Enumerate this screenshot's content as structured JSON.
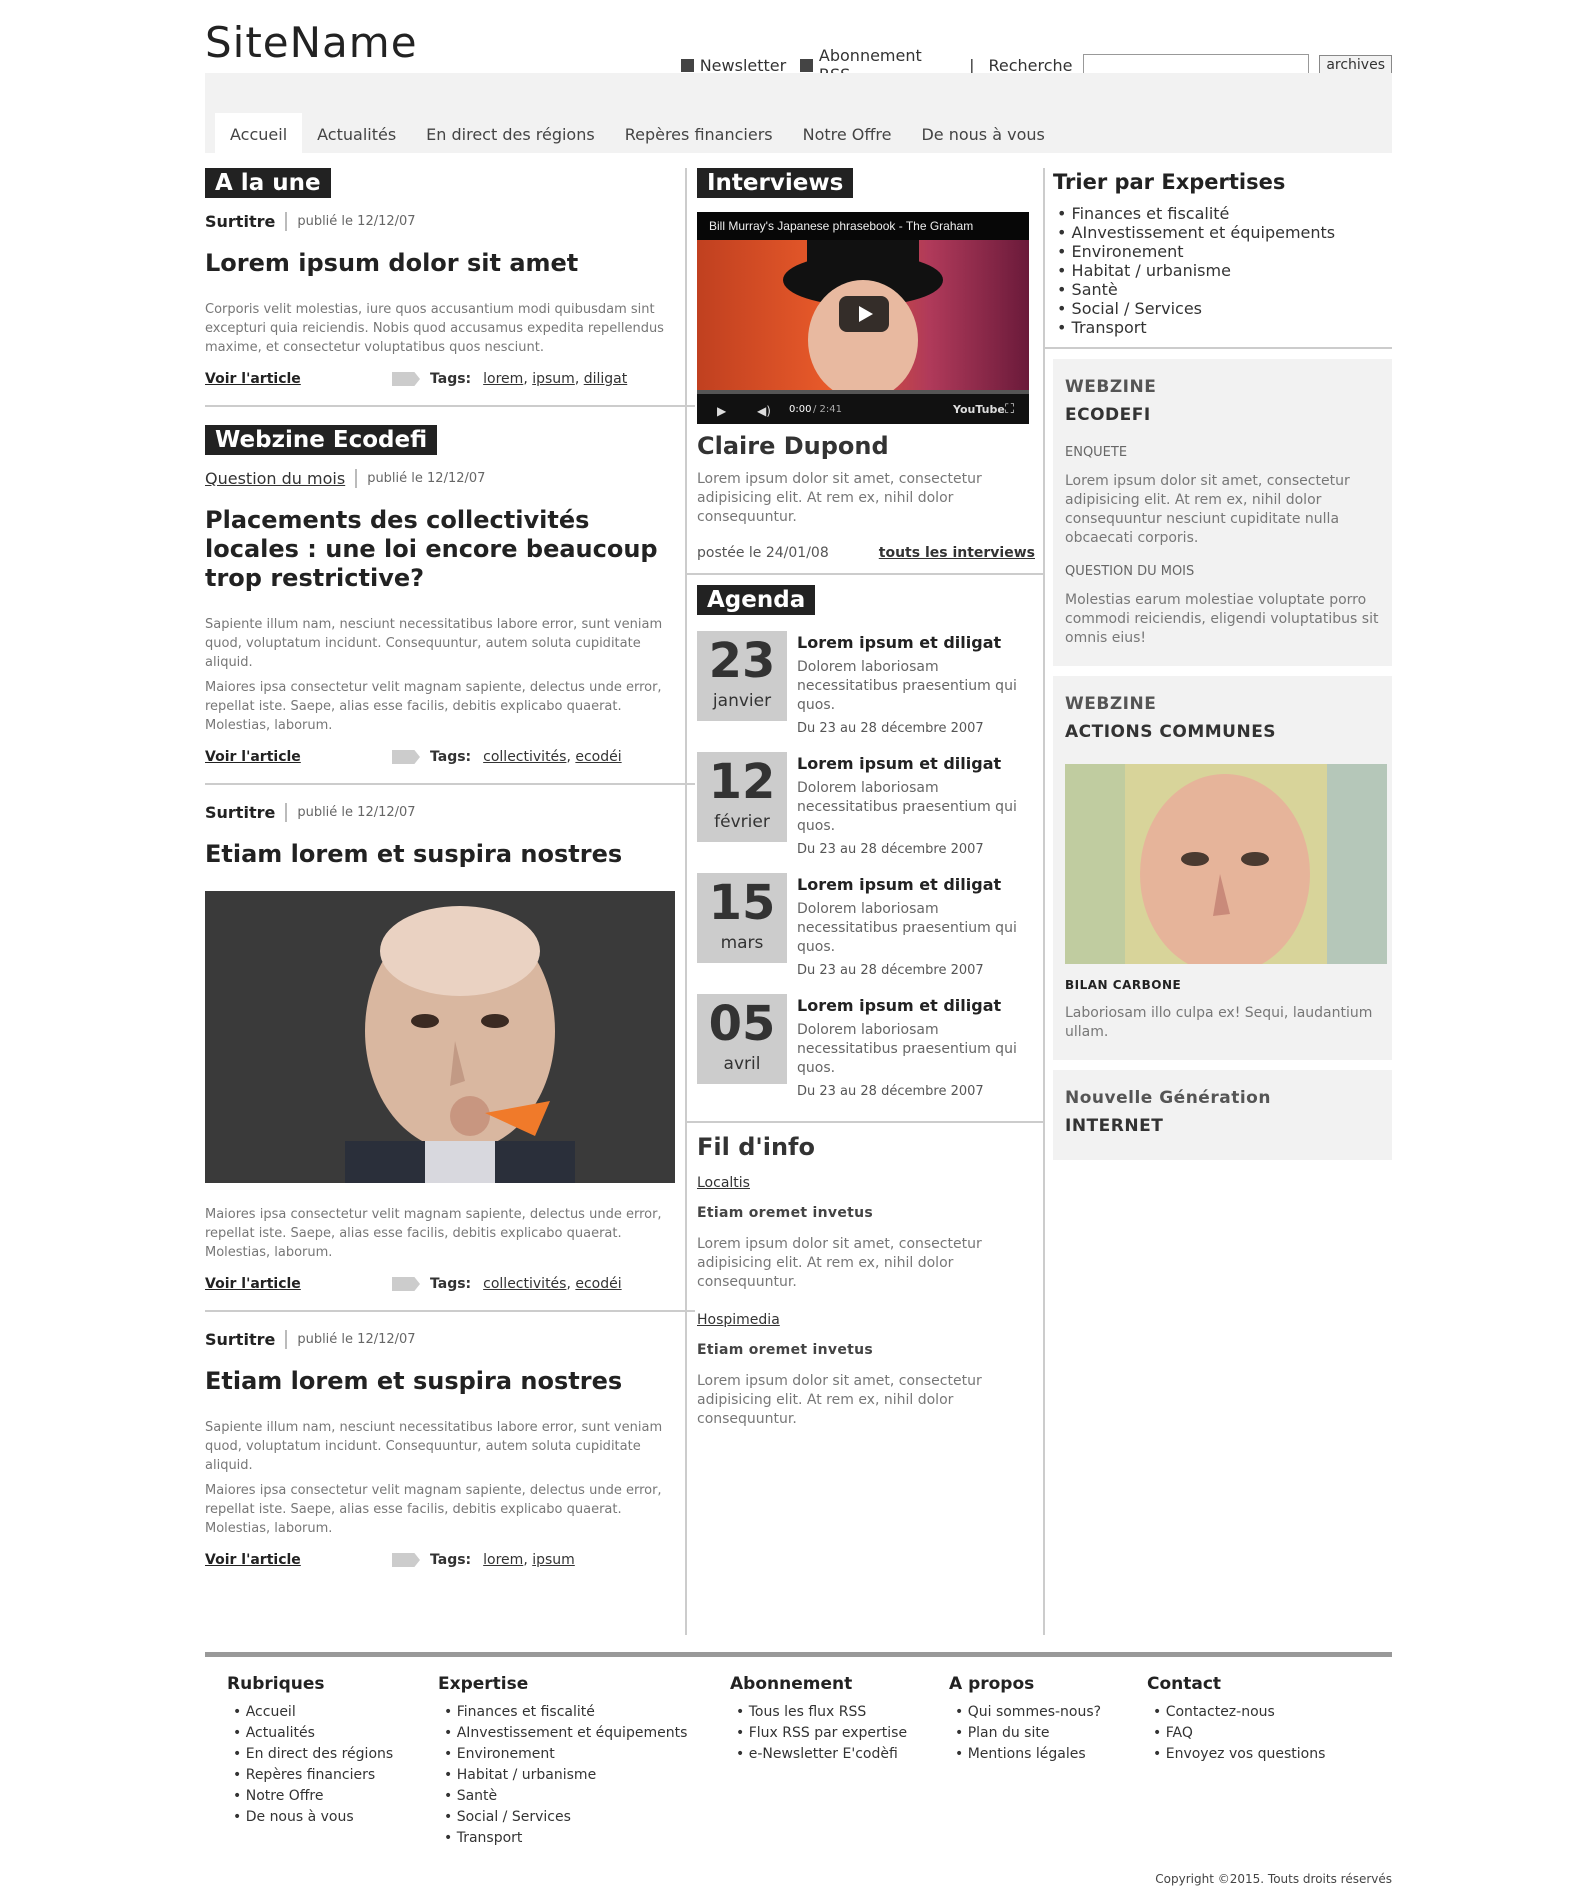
{
  "header": {
    "site_name": "SiteName",
    "newsletter": "Newsletter",
    "rss": "Abonnement RSS",
    "search_label": "Recherche",
    "search_value": "",
    "archives": "archives"
  },
  "nav": [
    "Accueil",
    "Actualités",
    "En direct des régions",
    "Repères financiers",
    "Notre Offre",
    "De nous à vous"
  ],
  "une": {
    "heading": "A la une",
    "surtitre": "Surtitre",
    "pub": "publié le 12/12/07",
    "title": "Lorem ipsum dolor sit amet",
    "body": "Corporis velit molestias, iure quos accusantium modi quibusdam sint excepturi quia reiciendis. Nobis quod accusamus expedita repellendus maxime, et consectetur voluptatibus quos nesciunt.",
    "voir": "Voir l'article",
    "tags_label": "Tags:",
    "tags": [
      "lorem",
      "ipsum",
      "diligat"
    ]
  },
  "webzine": {
    "heading": "Webzine Ecodefi",
    "surtitre": "Question du mois",
    "pub": "publié le 12/12/07",
    "title": "Placements des collectivités locales : une loi encore beaucoup trop restrictive?",
    "body1": "Sapiente illum nam, nesciunt necessitatibus labore error, sunt veniam quod, voluptatum incidunt. Consequuntur, autem soluta cupiditate aliquid.",
    "body2": "Maiores ipsa consectetur velit magnam sapiente, delectus unde error, repellat iste. Saepe, alias esse facilis, debitis explicabo quaerat. Molestias, laborum.",
    "voir": "Voir l'article",
    "tags_label": "Tags:",
    "tags": [
      "collectivités",
      "ecodéi"
    ]
  },
  "art3": {
    "surtitre": "Surtitre",
    "pub": "publié le 12/12/07",
    "title": "Etiam lorem et suspira nostres",
    "body": "Maiores ipsa consectetur velit magnam sapiente, delectus unde error, repellat iste. Saepe, alias esse facilis, debitis explicabo quaerat. Molestias, laborum.",
    "voir": "Voir l'article",
    "tags_label": "Tags:",
    "tags": [
      "collectivités",
      "ecodéi"
    ]
  },
  "art4": {
    "surtitre": "Surtitre",
    "pub": "publié le 12/12/07",
    "title": "Etiam lorem et suspira nostres",
    "body1": "Sapiente illum nam, nesciunt necessitatibus labore error, sunt veniam quod, voluptatum incidunt. Consequuntur, autem soluta cupiditate aliquid.",
    "body2": "Maiores ipsa consectetur velit magnam sapiente, delectus unde error, repellat iste. Saepe, alias esse facilis, debitis explicabo quaerat. Molestias, laborum.",
    "voir": "Voir l'article",
    "tags_label": "Tags:",
    "tags": [
      "lorem",
      "ipsum"
    ]
  },
  "interviews": {
    "heading": "Interviews",
    "video_title": "Bill Murray's Japanese phrasebook - The Graham",
    "video_time": "0:00",
    "video_duration": "/ 2:41",
    "youtube": "YouTube",
    "name": "Claire Dupond",
    "body": "Lorem ipsum dolor sit amet, consectetur adipisicing elit. At rem ex, nihil dolor consequuntur.",
    "posted": "postée le 24/01/08",
    "all": "touts les interviews"
  },
  "agenda": {
    "heading": "Agenda",
    "items": [
      {
        "day": "23",
        "month": "janvier",
        "title": "Lorem ipsum et diligat",
        "body": "Dolorem laboriosam necessitatibus praesentium qui quos.",
        "dates": "Du 23 au 28 décembre 2007"
      },
      {
        "day": "12",
        "month": "février",
        "title": "Lorem ipsum et diligat",
        "body": "Dolorem laboriosam necessitatibus praesentium qui quos.",
        "dates": "Du 23 au 28 décembre 2007"
      },
      {
        "day": "15",
        "month": "mars",
        "title": "Lorem ipsum et diligat",
        "body": "Dolorem laboriosam necessitatibus praesentium qui quos.",
        "dates": "Du 23 au 28 décembre 2007"
      },
      {
        "day": "05",
        "month": "avril",
        "title": "Lorem ipsum et diligat",
        "body": "Dolorem laboriosam necessitatibus praesentium qui quos.",
        "dates": "Du 23 au 28 décembre 2007"
      }
    ]
  },
  "fil": {
    "heading": "Fil d'info",
    "items": [
      {
        "source": "Localtis",
        "title": "Etiam oremet invetus",
        "body": "Lorem ipsum dolor sit amet, consectetur adipisicing elit. At rem ex, nihil dolor consequuntur."
      },
      {
        "source": "Hospimedia",
        "title": "Etiam oremet invetus",
        "body": "Lorem ipsum dolor sit amet, consectetur adipisicing elit. At rem ex, nihil dolor consequuntur."
      }
    ]
  },
  "expertises": {
    "heading": "Trier par Expertises",
    "items": [
      "Finances et fiscalité",
      "AInvestissement et équipements",
      "Environement",
      "Habitat / urbanisme",
      "Santè",
      "Social / Services",
      "Transport"
    ]
  },
  "box1": {
    "h1": "WEBZINE",
    "h2": "ECODEFI",
    "enquete": "ENQUETE",
    "enquete_body": "Lorem ipsum dolor sit amet, consectetur adipisicing elit. At rem ex, nihil dolor consequuntur nesciunt cupiditate nulla obcaecati corporis.",
    "question": "QUESTION DU MOIS",
    "question_body": "Molestias earum molestiae voluptate porro commodi reiciendis, eligendi voluptatibus sit omnis eius!"
  },
  "box2": {
    "h1": "WEBZINE",
    "h2": "ACTIONS COMMUNES",
    "bilan": "BILAN CARBONE",
    "body": "Laboriosam illo culpa ex! Sequi, laudantium ullam."
  },
  "box3": {
    "h1": "Nouvelle Génération",
    "h2": "INTERNET"
  },
  "footer": {
    "cols": [
      {
        "title": "Rubriques",
        "items": [
          "Accueil",
          "Actualités",
          "En direct des régions",
          "Repères financiers",
          "Notre Offre",
          "De nous à vous"
        ]
      },
      {
        "title": "Expertise",
        "items": [
          "Finances et fiscalité",
          "AInvestissement et équipements",
          "Environement",
          "Habitat / urbanisme",
          "Santè",
          "Social / Services",
          "Transport"
        ]
      },
      {
        "title": "Abonnement",
        "items": [
          "Tous les flux RSS",
          "Flux RSS par expertise",
          "e-Newsletter E'codèfi"
        ]
      },
      {
        "title": "A propos",
        "items": [
          "Qui sommes-nous?",
          "Plan du site",
          "Mentions légales"
        ]
      },
      {
        "title": "Contact",
        "items": [
          "Contactez-nous",
          "FAQ",
          "Envoyez vos questions"
        ]
      }
    ],
    "copyright": "Copyright ©2015. Touts droits réservés"
  }
}
